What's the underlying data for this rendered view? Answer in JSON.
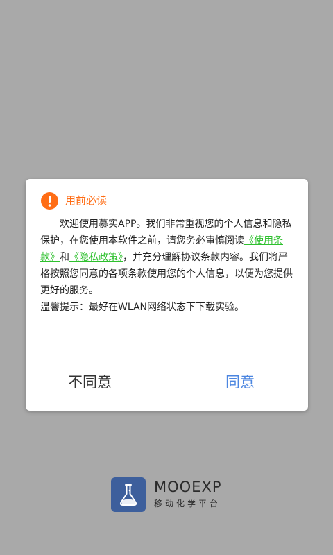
{
  "dialog": {
    "title": "用前必读",
    "intro_before_link1": "欢迎使用慕实APP。我们非常重视您的个人信息和隐私保护，在您使用本软件之前，请您务必审慎阅读",
    "link_terms": "《使用条款》",
    "and_text": "和",
    "link_privacy": "《隐私政策》",
    "intro_after_links": "，并充分理解协议条款内容。我们将严格按照您同意的各项条款使用您的个人信息，以便为您提供更好的服务。",
    "tip": "温馨提示：最好在WLAN网络状态下下载实验。",
    "disagree_label": "不同意",
    "agree_label": "同意"
  },
  "brand": {
    "name": "MOOEXP",
    "subtitle": "移动化学平台"
  },
  "colors": {
    "accent_orange": "#ff6d15",
    "link_green": "#2ec02e",
    "agree_blue": "#4c86e0",
    "logo_blue": "#3d5f9c",
    "overlay_gray": "#a9a9a9"
  },
  "icons": {
    "header": "info-icon",
    "logo": "flask-icon"
  }
}
